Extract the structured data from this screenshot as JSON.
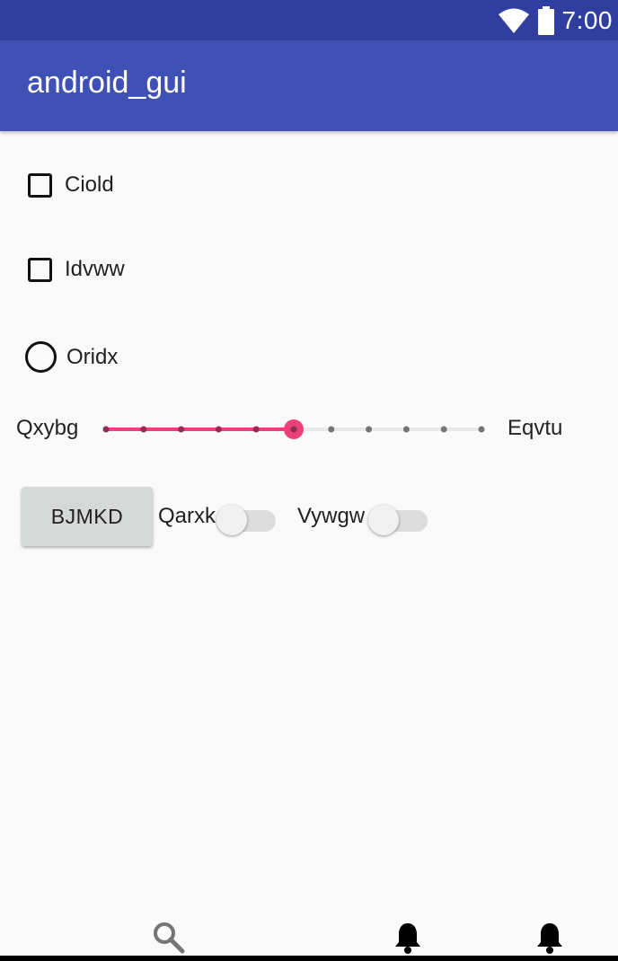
{
  "status_bar": {
    "time": "7:00",
    "icons": [
      "wifi-icon",
      "battery-icon"
    ]
  },
  "app_bar": {
    "title": "android_gui"
  },
  "checkboxes": [
    {
      "label": "Ciold",
      "checked": false
    },
    {
      "label": "Idvww",
      "checked": false
    }
  ],
  "radio": {
    "label": "Oridx",
    "selected": false
  },
  "seekbar": {
    "left_label": "Qxybg",
    "right_label": "Eqvtu",
    "steps": 10,
    "value": 5,
    "accent": "#ec407a"
  },
  "button": {
    "label": "BJMKD"
  },
  "switches": [
    {
      "label": "Qarxk",
      "on": false
    },
    {
      "label": "Vywgw",
      "on": false
    }
  ],
  "bottom_nav": {
    "icons": [
      "search-icon",
      "bell-icon",
      "bell-icon"
    ]
  },
  "colors": {
    "status_bar": "#303f9f",
    "app_bar": "#3f51b5",
    "background": "#fafafa"
  }
}
